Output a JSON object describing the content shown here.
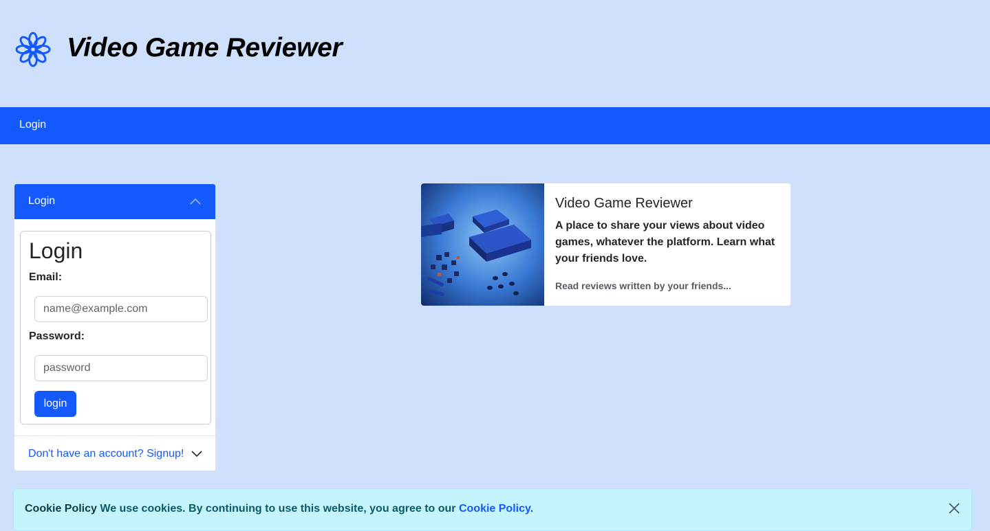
{
  "header": {
    "site_title": "Video Game Reviewer",
    "logo_icon": "flower-icon"
  },
  "nav": {
    "login_link": "Login"
  },
  "login_panel": {
    "accordion_header": "Login",
    "title": "Login",
    "email_label": "Email:",
    "email_placeholder": "name@example.com",
    "password_label": "Password:",
    "password_placeholder": "password",
    "submit_label": "login",
    "signup_toggle": "Don't have an account? Signup!"
  },
  "card": {
    "title": "Video Game Reviewer",
    "text": "A place to share your views about video games, whatever the platform. Learn what your friends love.",
    "subtext": "Read reviews written by your friends..."
  },
  "cookie_banner": {
    "heading": "Cookie Policy",
    "message": "We use cookies. By continuing to use this website, you agree to our",
    "link": "Cookie Policy",
    "period": "."
  },
  "colors": {
    "brand": "#1459fc",
    "background": "#cfe0fd"
  }
}
